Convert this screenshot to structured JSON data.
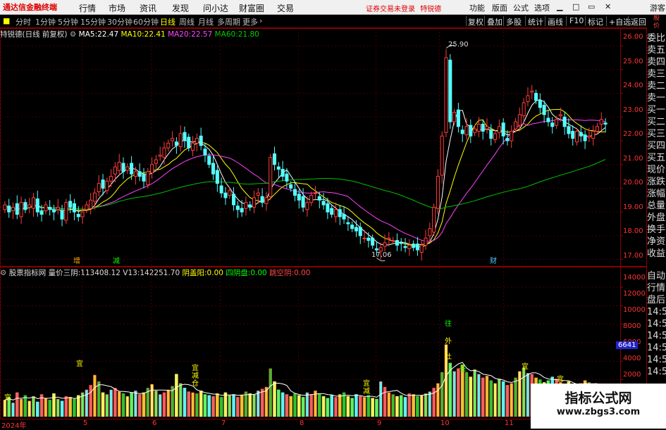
{
  "menubar": {
    "brand": "通达信金融终端",
    "menus": [
      "行情",
      "市场",
      "资讯",
      "发现",
      "问小达",
      "财富圈",
      "交易"
    ],
    "notice": "证券交易未登录",
    "notice_stock": "特锐德",
    "right_buttons": [
      "功能",
      "版面",
      "公式",
      "选项"
    ],
    "guest": "游客"
  },
  "periodbar": {
    "periods": [
      "分时",
      "1分钟",
      "5分钟",
      "15分钟",
      "30分钟",
      "60分钟",
      "日线",
      "周线",
      "月线",
      "多周期",
      "更多"
    ],
    "active": "日线",
    "tools": [
      "复权",
      "叠加",
      "多股",
      "统计",
      "画线",
      "F10",
      "标记",
      "+自选",
      "返回"
    ]
  },
  "main_info": {
    "stock_name": "特锐德(日线 前复权)",
    "ma5_label": "MA5:",
    "ma5": "22.47",
    "ma10_label": "MA10:",
    "ma10": "22.41",
    "ma20_label": "MA20:",
    "ma20": "22.57",
    "ma60_label": "MA60:",
    "ma60": "21.80",
    "colors": {
      "ma5": "#ffffff",
      "ma10": "#ffff00",
      "ma20": "#ff44ff",
      "ma60": "#00c000"
    }
  },
  "sub_info": {
    "name": "股票指标网",
    "f1_label": "量价三阴:",
    "f1": "113408.12",
    "f2_label": "V13:",
    "f2": "142251.70",
    "f3_label": "阴盖阳:",
    "f3": "0.00",
    "f4_label": "四阴盘:",
    "f4": "0.00",
    "f5_label": "跳空阴:",
    "f5": "0.00"
  },
  "price_axis": [
    "26.00",
    "25.00",
    "24.00",
    "23.00",
    "22.00",
    "21.00",
    "20.00",
    "19.00",
    "18.00",
    "17.00"
  ],
  "volume_axis": [
    "14000",
    "12000",
    "10000",
    "8000",
    "6000",
    "4000",
    "2000"
  ],
  "volume_tag": "6641",
  "annotations": {
    "high": "25.90",
    "low": "17.06"
  },
  "markers": {
    "m1": "增",
    "m2": "减",
    "m3": "",
    "m4": "财"
  },
  "x_axis": [
    "2024年",
    "5",
    "6",
    "7",
    "8",
    "9",
    "10",
    "11"
  ],
  "vol_labels": {
    "a": "宜",
    "b": "宜减",
    "c": "宜",
    "d": "宜减仓",
    "e": "往",
    "f": "外",
    "g": "吐",
    "h": "往"
  },
  "sidebar_top": [
    "委比",
    "卖五",
    "卖四",
    "卖三",
    "卖二",
    "卖一",
    "买一",
    "买二",
    "买三",
    "买四",
    "买五",
    "现价",
    "涨跌",
    "涨幅",
    "总量",
    "外盘",
    "换手",
    "净资",
    "收益"
  ],
  "sidebar_bottom": [
    "自动",
    "行情",
    "盘后",
    "14:5",
    "14:5",
    "14:5",
    "14:5",
    "14:5",
    "14:5",
    "14:5",
    "14:5",
    "14:5",
    "14:5",
    "14:5"
  ],
  "sidebar_corner": [
    "股",
    "价"
  ],
  "watermark": {
    "title": "指标公式网",
    "url": "www.zbgs3.com"
  },
  "chart_data": [
    {
      "type": "candlestick",
      "title": "特锐德(日线 前复权)",
      "ylim": [
        16.9,
        26.3
      ],
      "x": [
        "2024年",
        "5",
        "6",
        "7",
        "8",
        "9",
        "10",
        "11"
      ],
      "close": [
        19.3,
        19.0,
        19.2,
        18.9,
        19.4,
        19.1,
        19.3,
        19.6,
        19.0,
        18.9,
        19.3,
        19.1,
        19.0,
        19.2,
        18.7,
        19.4,
        19.2,
        19.0,
        18.8,
        19.0,
        19.3,
        19.5,
        19.8,
        20.2,
        20.0,
        20.3,
        20.5,
        20.9,
        21.1,
        20.7,
        20.9,
        20.6,
        20.7,
        20.5,
        20.3,
        20.7,
        21.0,
        21.2,
        21.4,
        21.7,
        21.9,
        22.1,
        21.8,
        22.3,
        22.0,
        21.7,
        21.9,
        22.1,
        21.8,
        21.4,
        21.0,
        20.6,
        20.2,
        19.8,
        19.6,
        19.9,
        19.3,
        19.1,
        19.0,
        19.4,
        19.2,
        19.6,
        19.8,
        19.4,
        19.6,
        21.3,
        21.0,
        20.8,
        20.5,
        20.3,
        20.0,
        19.7,
        19.5,
        19.2,
        19.4,
        19.7,
        19.8,
        19.5,
        19.3,
        19.0,
        18.9,
        19.1,
        18.8,
        18.7,
        18.5,
        18.3,
        18.2,
        18.0,
        17.9,
        17.8,
        17.6,
        17.4,
        17.5,
        17.7,
        17.9,
        17.8,
        17.6,
        17.7,
        17.5,
        17.6,
        17.5,
        17.4,
        17.6,
        17.9,
        18.3,
        19.2,
        20.5,
        22.2,
        25.5,
        22.8,
        23.2,
        22.6,
        22.3,
        22.6,
        22.2,
        22.5,
        22.7,
        22.4,
        22.6,
        22.1,
        22.3,
        22.6,
        22.2,
        22.0,
        22.4,
        22.8,
        23.1,
        23.6,
        23.9,
        24.1,
        23.7,
        23.4,
        23.1,
        22.8,
        22.6,
        22.9,
        23.1,
        22.6,
        22.3,
        22.1,
        22.4,
        22.2,
        22.0,
        22.2,
        22.4,
        22.6,
        22.9,
        22.7
      ],
      "ma_last": {
        "MA5": 22.47,
        "MA10": 22.41,
        "MA20": 22.57,
        "MA60": 21.8
      },
      "high_label": 25.9,
      "low_label": 17.06
    },
    {
      "type": "bar",
      "title": "股票指标网",
      "ylim": [
        0,
        15000
      ],
      "values": [
        1800,
        2100,
        1500,
        2600,
        1900,
        2300,
        1700,
        2200,
        1600,
        2400,
        2000,
        1800,
        2500,
        1900,
        1700,
        2200,
        2100,
        1900,
        2300,
        2600,
        2900,
        3400,
        4500,
        3800,
        2600,
        2400,
        2900,
        3100,
        2700,
        2500,
        2200,
        2600,
        2800,
        2400,
        2600,
        3100,
        3500,
        2800,
        2400,
        2600,
        2900,
        3300,
        4600,
        3600,
        3100,
        2700,
        2600,
        2500,
        2800,
        2400,
        2300,
        2200,
        2500,
        2100,
        2600,
        2300,
        2400,
        2100,
        2300,
        2700,
        2500,
        2400,
        2800,
        3000,
        3200,
        5200,
        3800,
        2900,
        2600,
        2400,
        2200,
        2500,
        2300,
        2100,
        2600,
        2400,
        2800,
        2500,
        2200,
        2000,
        2300,
        2100,
        2400,
        2600,
        2200,
        2000,
        2400,
        2200,
        2100,
        2300,
        2000,
        1900,
        3800,
        3200,
        2600,
        2400,
        2200,
        2300,
        2100,
        2500,
        2400,
        2200,
        2300,
        2500,
        2700,
        3100,
        3600,
        4800,
        7800,
        5800,
        4900,
        5200,
        5600,
        4800,
        4300,
        5100,
        4600,
        4200,
        4400,
        3900,
        3600,
        4100,
        3800,
        3400,
        3600,
        4200,
        4900,
        5300,
        4700,
        4600,
        4200,
        4000,
        3700,
        3900,
        4300,
        4100,
        3700,
        3500,
        3800,
        3400,
        3200,
        3600,
        3900,
        3700,
        3400,
        3300
      ],
      "volume_tag": 6641
    }
  ]
}
